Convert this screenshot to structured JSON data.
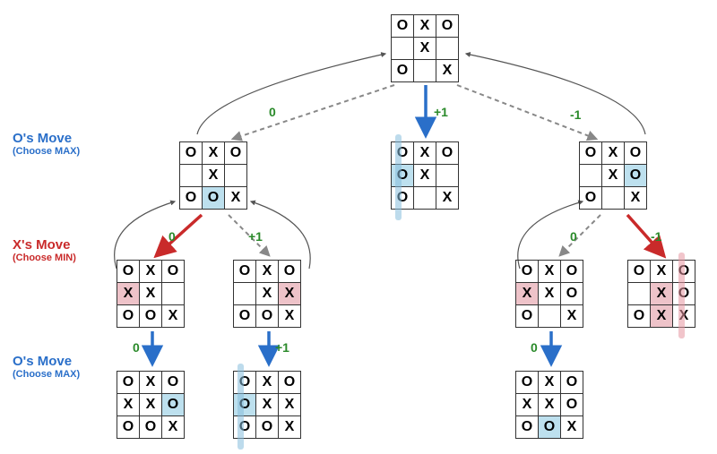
{
  "labels": {
    "o_move": "O's Move",
    "choose_max": "(Choose MAX)",
    "x_move": "X's Move",
    "choose_min": "(Choose MIN)"
  },
  "scores": {
    "root_left": "0",
    "root_mid": "+1",
    "root_right": "-1",
    "l2_left_a": "0",
    "l2_left_b": "+1",
    "l2_right_a": "0",
    "l2_right_b": "-1",
    "l3_left_a": "0",
    "l3_left_b": "+1",
    "l3_right_a": "0"
  },
  "boards": {
    "root": [
      [
        "O",
        "X",
        "O"
      ],
      [
        "",
        "X",
        ""
      ],
      [
        "O",
        "",
        "X"
      ]
    ],
    "l1_left": [
      [
        "O",
        "X",
        "O"
      ],
      [
        "",
        "X",
        ""
      ],
      [
        "O",
        "O",
        "X"
      ]
    ],
    "l1_mid": [
      [
        "O",
        "X",
        "O"
      ],
      [
        "O",
        "X",
        ""
      ],
      [
        "O",
        "",
        "X"
      ]
    ],
    "l1_right": [
      [
        "O",
        "X",
        "O"
      ],
      [
        "",
        "X",
        "O"
      ],
      [
        "O",
        "",
        "X"
      ]
    ],
    "l2_ll": [
      [
        "O",
        "X",
        "O"
      ],
      [
        "X",
        "X",
        ""
      ],
      [
        "O",
        "O",
        "X"
      ]
    ],
    "l2_lr": [
      [
        "O",
        "X",
        "O"
      ],
      [
        "",
        "X",
        "X"
      ],
      [
        "O",
        "O",
        "X"
      ]
    ],
    "l2_rl": [
      [
        "O",
        "X",
        "O"
      ],
      [
        "X",
        "X",
        "O"
      ],
      [
        "O",
        "",
        "X"
      ]
    ],
    "l2_rr": [
      [
        "O",
        "X",
        "O"
      ],
      [
        "",
        "X",
        "O"
      ],
      [
        "O",
        "X",
        "X"
      ]
    ],
    "l3_a": [
      [
        "O",
        "X",
        "O"
      ],
      [
        "X",
        "X",
        "O"
      ],
      [
        "O",
        "O",
        "X"
      ]
    ],
    "l3_b": [
      [
        "O",
        "X",
        "O"
      ],
      [
        "O",
        "X",
        "X"
      ],
      [
        "O",
        "O",
        "X"
      ]
    ],
    "l3_c": [
      [
        "O",
        "X",
        "O"
      ],
      [
        "X",
        "X",
        "O"
      ],
      [
        "O",
        "O",
        "X"
      ]
    ]
  },
  "highlights": {
    "l1_left": [
      [
        2,
        1,
        "blue"
      ]
    ],
    "l1_mid": [
      [
        1,
        0,
        "blue"
      ]
    ],
    "l1_right": [
      [
        1,
        2,
        "blue"
      ]
    ],
    "l2_ll": [
      [
        1,
        0,
        "pink"
      ]
    ],
    "l2_lr": [
      [
        1,
        2,
        "pink"
      ]
    ],
    "l2_rl": [
      [
        1,
        0,
        "pink"
      ]
    ],
    "l2_rr": [
      [
        1,
        1,
        "pink"
      ],
      [
        2,
        1,
        "pink"
      ]
    ],
    "l3_a": [
      [
        1,
        2,
        "blue"
      ]
    ],
    "l3_b": [
      [
        1,
        0,
        "blue"
      ]
    ],
    "l3_c": [
      [
        2,
        1,
        "blue"
      ]
    ]
  }
}
